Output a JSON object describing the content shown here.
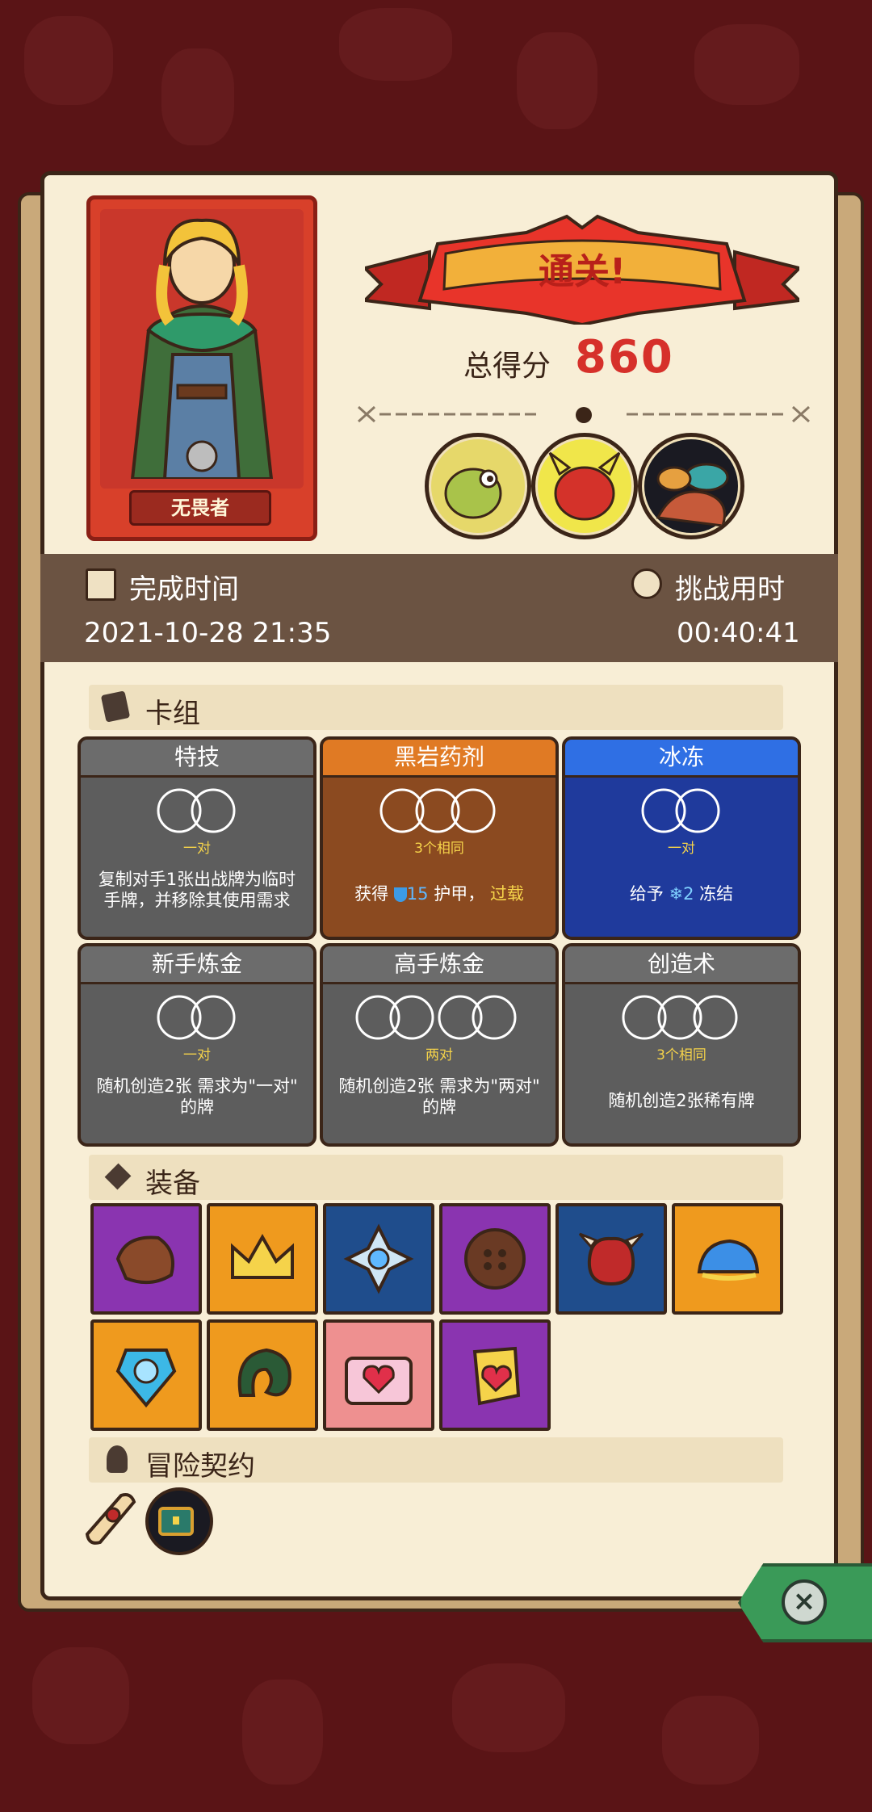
{
  "result": {
    "banner_text": "通关!",
    "total_label": "总得分",
    "total_score": "860",
    "hero_name": "无畏者"
  },
  "stats": {
    "complete_label": "完成时间",
    "complete_value": "2021-10-28 21:35",
    "challenge_label": "挑战用时",
    "challenge_value": "00:40:41"
  },
  "deck": {
    "title": "卡组",
    "cards": [
      {
        "name": "特技",
        "requirement": "一对",
        "desc_lines": [
          "复制对手1张出战牌为临时",
          "手牌，并移除其使用需求"
        ]
      },
      {
        "name": "黑岩药剂",
        "requirement": "3个相同",
        "desc_prefix": "获得",
        "desc_num": "15",
        "desc_mid": "护甲，",
        "desc_suffix": "过载"
      },
      {
        "name": "冰冻",
        "requirement": "一对",
        "desc_prefix": "给予",
        "desc_num": "2",
        "desc_suffix": "冻结"
      },
      {
        "name": "新手炼金",
        "requirement": "一对",
        "desc_lines": [
          "随机创造2张 需求为\"一对\"",
          "的牌"
        ]
      },
      {
        "name": "高手炼金",
        "requirement": "两对",
        "desc_lines": [
          "随机创造2张 需求为\"两对\"",
          "的牌"
        ]
      },
      {
        "name": "创造术",
        "requirement": "3个相同",
        "desc_lines": [
          "随机创造2张稀有牌"
        ]
      }
    ]
  },
  "equipment": {
    "title": "装备",
    "items": [
      "leather-pad-icon",
      "crown-icon",
      "snowflake-gem-icon",
      "wooden-button-icon",
      "horned-blob-icon",
      "blue-slime-icon",
      "ice-shield-icon",
      "green-horn-icon",
      "heart-box-icon",
      "heart-gem-icon"
    ]
  },
  "contracts": {
    "title": "冒险契约",
    "items": [
      "scroll-icon",
      "treasure-chest-icon"
    ]
  },
  "colors": {
    "accent_red": "#d6302a",
    "panel": "#f8eed6",
    "bar": "#6b5342",
    "close_green": "#3a9a58"
  }
}
